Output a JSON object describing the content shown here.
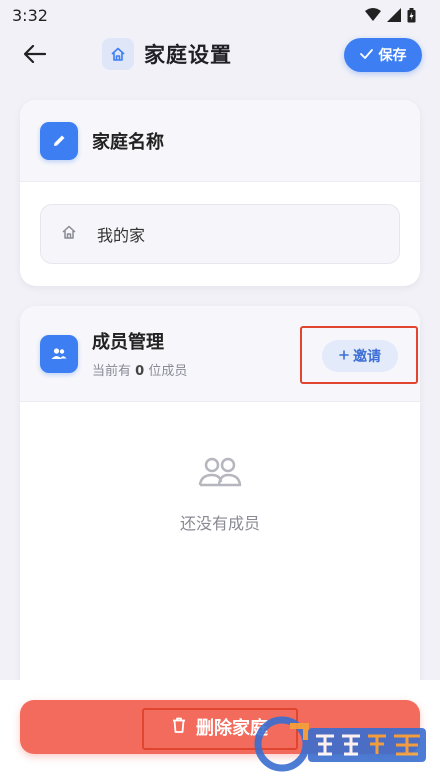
{
  "status_bar": {
    "time": "3:32"
  },
  "header": {
    "title": "家庭设置",
    "save_label": "保存"
  },
  "family_name_card": {
    "title": "家庭名称",
    "input_value": "我的家"
  },
  "members_card": {
    "title": "成员管理",
    "subtitle_prefix": "当前有",
    "member_count": "0",
    "subtitle_suffix": "位成员",
    "invite_label": "邀请",
    "empty_text": "还没有成员"
  },
  "footer": {
    "delete_label": "删除家庭"
  },
  "colors": {
    "accent": "#3d7ef2",
    "danger": "#f26b5c",
    "highlight": "#e0452f"
  }
}
